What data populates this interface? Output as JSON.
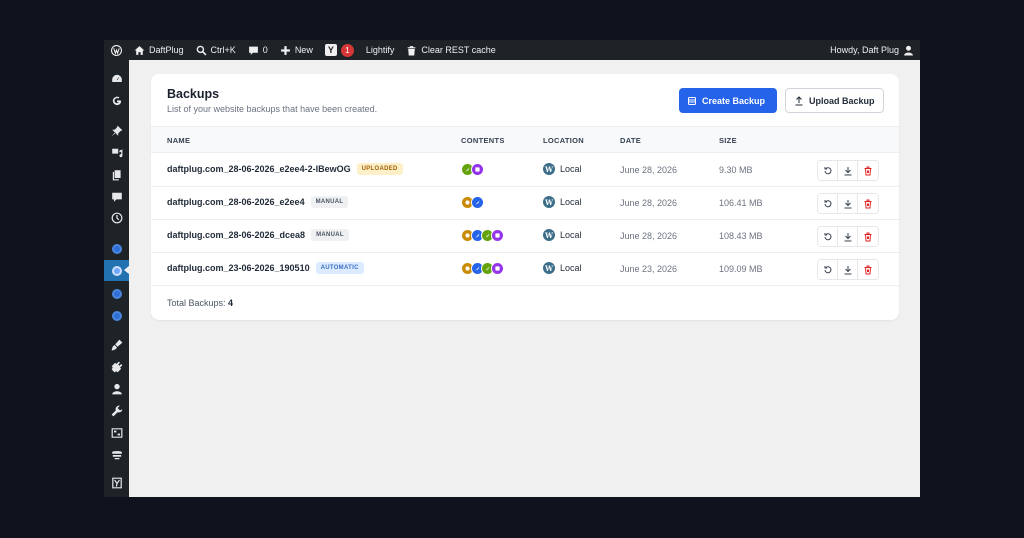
{
  "adminbar": {
    "site_name": "DaftPlug",
    "search_shortcut": "Ctrl+K",
    "comments_count": "0",
    "new_label": "New",
    "yoast_count": "1",
    "lightify_label": "Lightify",
    "clear_cache_label": "Clear REST cache",
    "howdy": "Howdy, Daft Plug"
  },
  "panel": {
    "title": "Backups",
    "subtitle": "List of your website backups that have been created.",
    "create_label": "Create Backup",
    "upload_label": "Upload Backup"
  },
  "table": {
    "headers": {
      "name": "NAME",
      "contents": "CONTENTS",
      "location": "LOCATION",
      "date": "DATE",
      "size": "SIZE"
    },
    "rows": [
      {
        "name": "daftplug.com_28-06-2026_e2ee4-2-lBewOG",
        "badge": "UPLOADED",
        "location": "Local",
        "date": "June 28, 2026",
        "size": "9.30 MB"
      },
      {
        "name": "daftplug.com_28-06-2026_e2ee4",
        "badge": "MANUAL",
        "location": "Local",
        "date": "June 28, 2026",
        "size": "106.41 MB"
      },
      {
        "name": "daftplug.com_28-06-2026_dcea8",
        "badge": "MANUAL",
        "location": "Local",
        "date": "June 28, 2026",
        "size": "108.43 MB"
      },
      {
        "name": "daftplug.com_23-06-2026_190510",
        "badge": "AUTOMATIC",
        "location": "Local",
        "date": "June 23, 2026",
        "size": "109.09 MB"
      }
    ]
  },
  "footer": {
    "total_label": "Total Backups:",
    "total_value": "4"
  },
  "colors": {
    "primary": "#2563eb",
    "admin_bar": "#1d2327",
    "delete": "#dc2626"
  }
}
